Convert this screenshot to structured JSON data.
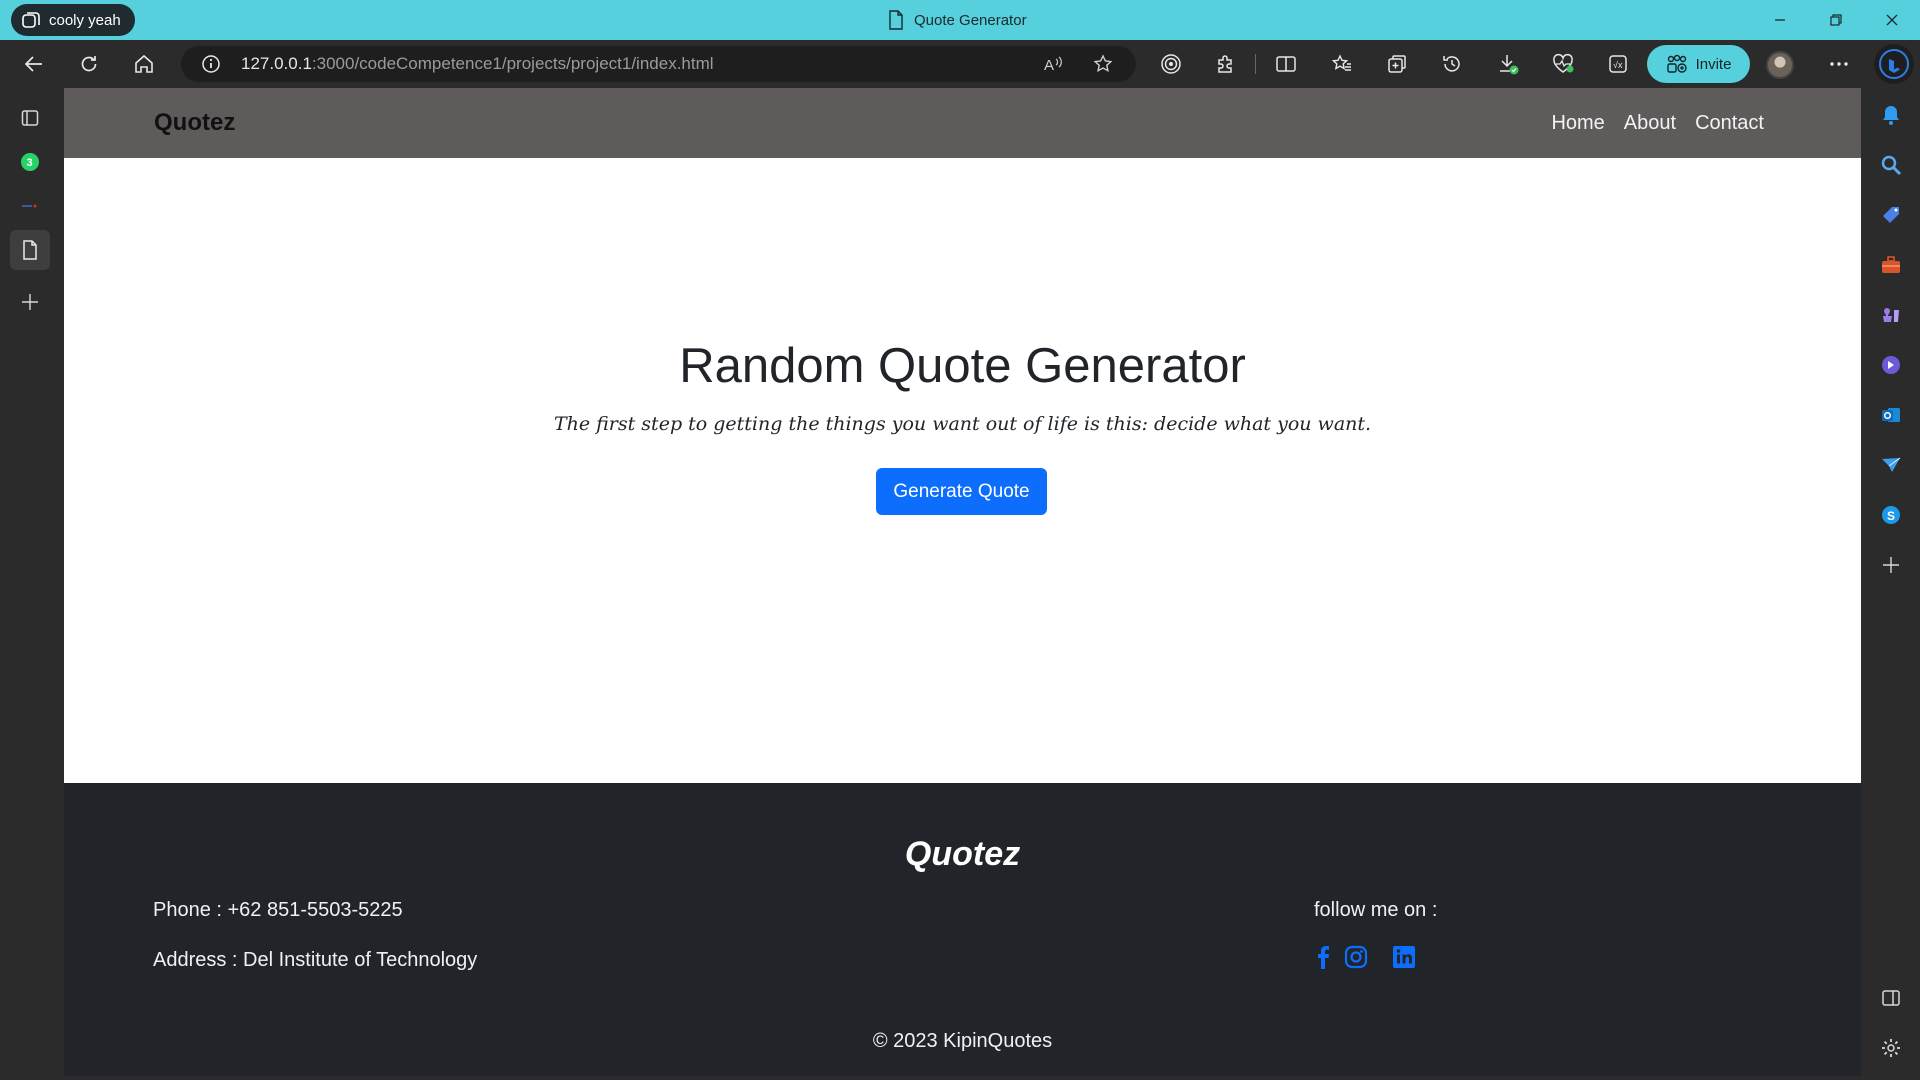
{
  "browser": {
    "profile_name": "cooly yeah",
    "tab_title": "Quote Generator",
    "url_host": "127.0.0.1",
    "url_rest": ":3000/codeCompetence1/projects/project1/index.html",
    "invite_label": "Invite",
    "whatsapp_badge": "3",
    "accent_color": "#56d0dc"
  },
  "site": {
    "brand": "Quotez",
    "nav": [
      "Home",
      "About",
      "Contact"
    ],
    "hero_title": "Random Quote Generator",
    "quote": "The first step to getting the things you want out of life is this: decide what you want.",
    "button_label": "Generate Quote",
    "button_color": "#0d6efd"
  },
  "footer": {
    "brand": "Quotez",
    "phone": "Phone : +62 851-5503-5225",
    "address": "Address : Del Institute of Technology",
    "follow": "follow me on :",
    "socials": [
      "facebook-icon",
      "instagram-icon",
      "linkedin-icon"
    ],
    "copyright": "© 2023 KipinQuotes"
  }
}
